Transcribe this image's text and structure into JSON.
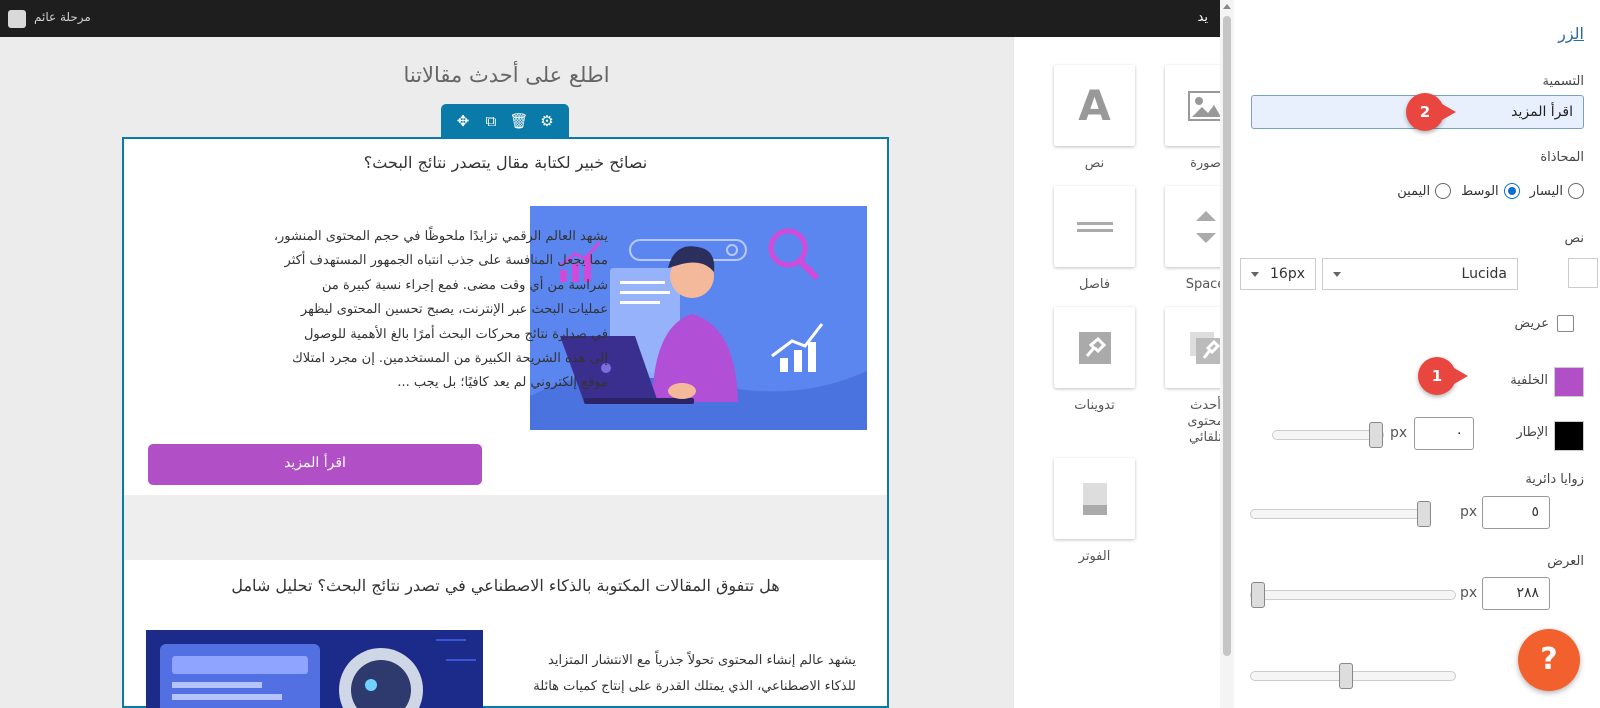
{
  "topbar": {
    "site_name": "مرحلة عائم",
    "cut_text": "يد"
  },
  "canvas": {
    "section_title": "اطلع على أحدث مقالاتنا",
    "posts": [
      {
        "title": "نصائح خبير لكتابة مقال يتصدر نتائج البحث؟",
        "excerpt_lines": [
          "يشهد العالم الرقمي تزايدًا ملحوظًا في حجم المحتوى المنشور،",
          "مما يجعل المنافسة على جذب انتباه الجمهور المستهدف أكثر",
          "شراسة من أي وقت مضى. فمع إجراء نسبة كبيرة من",
          "عمليات البحث عبر الإنترنت، يصبح تحسين المحتوى ليظهر",
          "في صدارة نتائج محركات البحث أمرًا بالغ الأهمية للوصول",
          "إلى هذه الشريحة الكبيرة من المستخدمين. إن مجرد امتلاك",
          "موقع إلكتروني لم يعد كافيًا؛ بل يجب ..."
        ],
        "button_label": "اقرأ المزيد"
      },
      {
        "title": "هل تتفوق المقالات المكتوبة بالذكاء الاصطناعي في تصدر نتائج البحث؟ تحليل شامل",
        "excerpt_lines": [
          "يشهد عالم إنشاء المحتوى تحولاً جذرياً مع الانتشار المتزايد",
          "للذكاء الاصطناعي، الذي يمتلك القدرة على إنتاج كميات هائلة"
        ]
      }
    ]
  },
  "blocks": [
    {
      "name": "image",
      "label": "صورة",
      "icon": "image-icon"
    },
    {
      "name": "text",
      "label": "نص",
      "icon": "text-icon"
    },
    {
      "name": "space",
      "label": "Space",
      "icon": "spacer-icon"
    },
    {
      "name": "divider",
      "label": "فاصل",
      "icon": "divider-icon"
    },
    {
      "name": "latest-content",
      "label": "أحدث\nمحتوى\nتلقائي",
      "icon": "pin-stack-icon"
    },
    {
      "name": "posts",
      "label": "تدوينات",
      "icon": "pin-icon"
    },
    {
      "name": "footer",
      "label": "الفوتر",
      "icon": "footer-icon"
    }
  ],
  "settings": {
    "title": "الزر",
    "label_field_label": "التسمية",
    "label_value": "اقرأ المزيد",
    "alignment_label": "المحاذاة",
    "alignment_options": [
      "اليسار",
      "الوسط",
      "اليمين"
    ],
    "alignment_selected": "الوسط",
    "text_label": "نص",
    "font_family": "Lucida",
    "font_size": "16px",
    "bold_label": "عريض",
    "background_label": "الخلفية",
    "background_color": "#b14fc6",
    "border_label": "الإطار",
    "border_color": "#000000",
    "border_value": "٠",
    "radius_label": "زوايا دائرية",
    "radius_value": "٥",
    "width_label": "العرض",
    "width_value": "٢٨٨",
    "unit": "px",
    "callout_1": "1",
    "callout_2": "2"
  },
  "help_label": "?"
}
